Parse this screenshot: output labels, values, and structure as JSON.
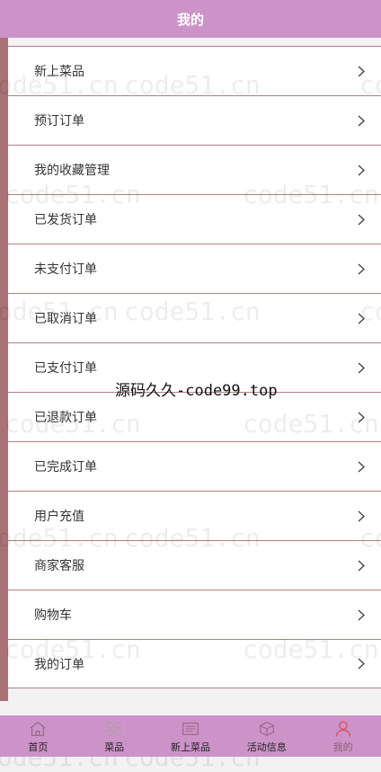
{
  "header": {
    "title": "我的"
  },
  "menu": {
    "items": [
      {
        "label": "新上菜品"
      },
      {
        "label": "预订订单"
      },
      {
        "label": "我的收藏管理"
      },
      {
        "label": "已发货订单"
      },
      {
        "label": "未支付订单"
      },
      {
        "label": "已取消订单"
      },
      {
        "label": "已支付订单"
      },
      {
        "label": "已退款订单"
      },
      {
        "label": "已完成订单"
      },
      {
        "label": "用户充值"
      },
      {
        "label": "商家客服"
      },
      {
        "label": "购物车"
      },
      {
        "label": "我的订单"
      }
    ]
  },
  "watermark": {
    "text": "code51.cn"
  },
  "overlay_note": "源码久久-code99.top",
  "tabbar": {
    "items": [
      {
        "label": "首页",
        "icon": "home-icon"
      },
      {
        "label": "菜品",
        "icon": "grid-icon"
      },
      {
        "label": "新上菜品",
        "icon": "news-icon"
      },
      {
        "label": "活动信息",
        "icon": "box-icon"
      },
      {
        "label": "我的",
        "icon": "user-icon",
        "active": true
      }
    ]
  },
  "colors": {
    "header_bg": "#cc93c9",
    "tabbar_bg": "#cc93c9",
    "sidebar_bar": "#a87276",
    "divider": "#b18082",
    "active_icon": "#d9535f"
  }
}
